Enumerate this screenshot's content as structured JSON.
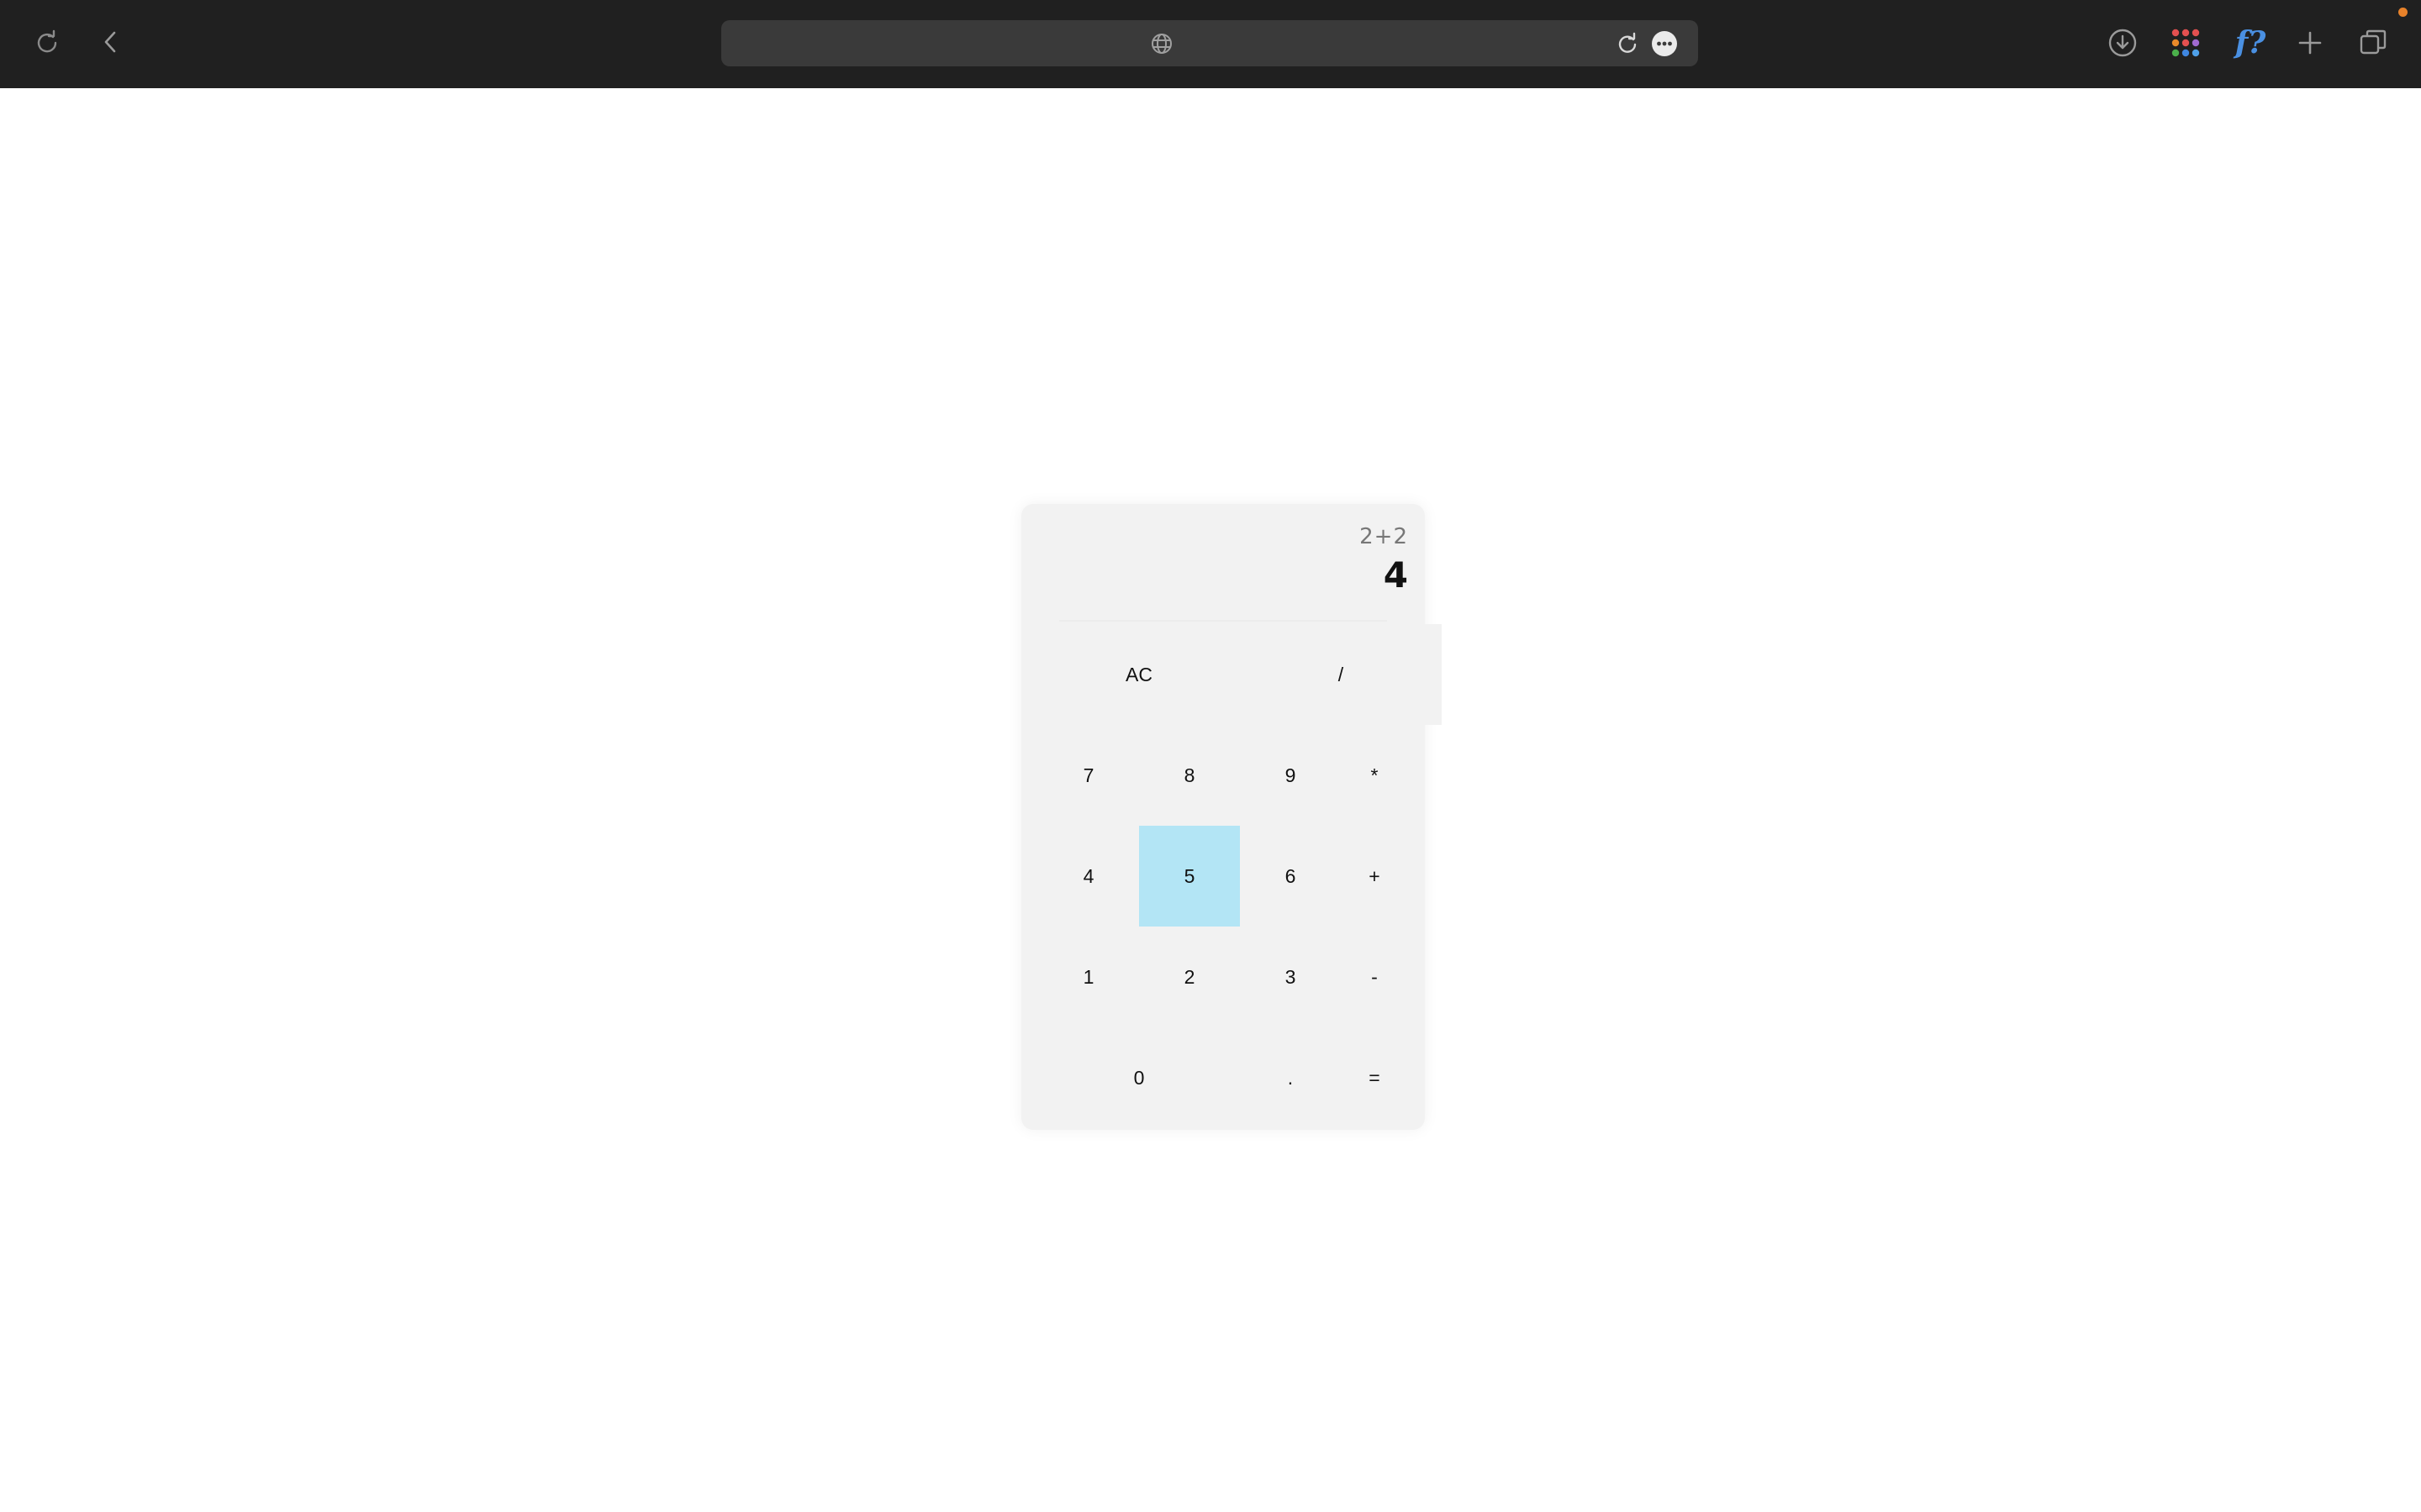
{
  "browser": {
    "toolbar_icons": [
      "refresh-icon",
      "back-icon",
      "globe-icon",
      "reload-icon",
      "more-icon",
      "download-icon",
      "apps-grid-icon",
      "formula-icon",
      "new-tab-icon",
      "tabs-icon"
    ],
    "formula_label": "f?",
    "accent": "#e8822a"
  },
  "calculator": {
    "expression": "2+2",
    "result": "4",
    "keys": {
      "ac": "AC",
      "divide": "/",
      "seven": "7",
      "eight": "8",
      "nine": "9",
      "multiply": "*",
      "four": "4",
      "five": "5",
      "six": "6",
      "plus": "+",
      "one": "1",
      "two": "2",
      "three": "3",
      "minus": "-",
      "zero": "0",
      "dot": ".",
      "equals": "="
    },
    "highlight_color": "#b3e5f5"
  }
}
